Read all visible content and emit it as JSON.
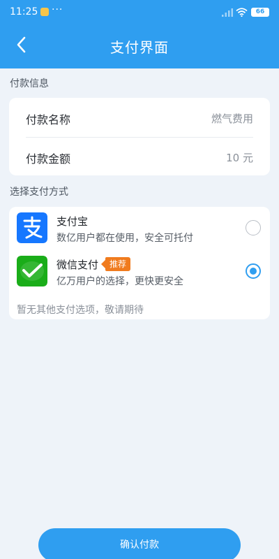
{
  "status_bar": {
    "time": "11:25",
    "dots": "···",
    "battery": "66"
  },
  "nav": {
    "title": "支付界面"
  },
  "payment_info": {
    "section_label": "付款信息",
    "rows": [
      {
        "label": "付款名称",
        "value": "燃气费用"
      },
      {
        "label": "付款金额",
        "value": "10 元"
      }
    ]
  },
  "payment_methods": {
    "section_label": "选择支付方式",
    "options": [
      {
        "name": "支付宝",
        "desc": "数亿用户都在使用，安全可托付",
        "selected": false,
        "badge": ""
      },
      {
        "name": "微信支付",
        "desc": "亿万用户的选择，更快更安全",
        "selected": true,
        "badge": "推荐"
      }
    ],
    "note": "暂无其他支付选项，敬请期待"
  },
  "colors": {
    "primary": "#2f9ef0",
    "alipay": "#1677ff",
    "wechat": "#1aad19",
    "badge": "#f07b1e"
  },
  "confirm": {
    "label": "确认付款"
  }
}
